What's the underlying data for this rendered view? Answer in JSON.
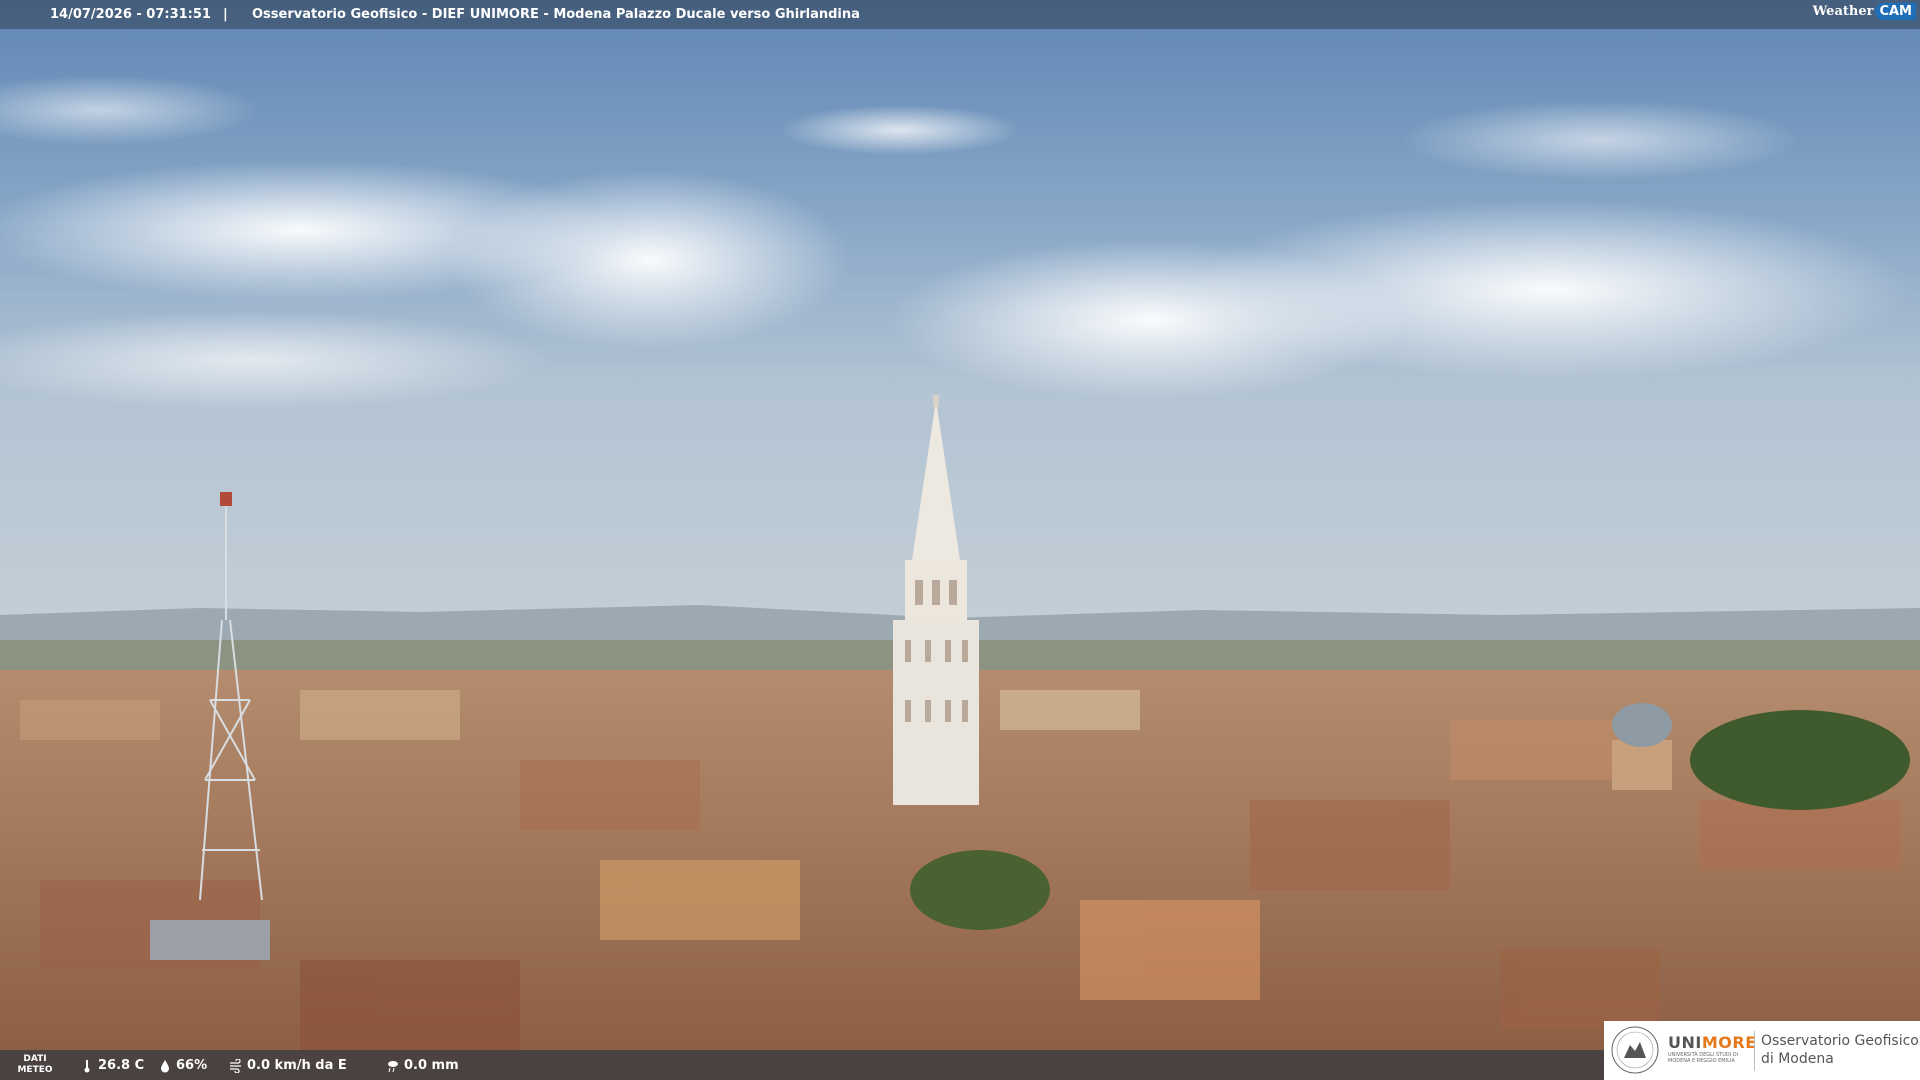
{
  "header": {
    "timestamp": "14/07/2026 - 07:31:51",
    "separator": "|",
    "title": "Osservatorio Geofisico - DIEF UNIMORE - Modena Palazzo Ducale verso Ghirlandina",
    "brand_weather": "Weather",
    "brand_cam": "CAM"
  },
  "footer": {
    "dati_label_1": "DATI",
    "dati_label_2": "METEO",
    "temperature": "26.8 C",
    "humidity": "66%",
    "wind": "0.0 km/h da E",
    "rain": "0.0 mm",
    "icons": [
      "thermometer-icon",
      "humidity-drop-icon",
      "wind-icon",
      "rain-icon"
    ]
  },
  "logo": {
    "uni_prefix": "UNI",
    "uni_suffix": "MORE",
    "uni_subtitle": "UNIVERSITÀ DEGLI STUDI DI MODENA E REGGIO EMILIA",
    "observatory_line1": "Osservatorio Geofisico",
    "observatory_line2": "di Modena"
  },
  "colors": {
    "header_bar": "#3c5069",
    "brand_cam_bg": "#1e6fb8",
    "unimore_orange": "#e57a1a"
  }
}
